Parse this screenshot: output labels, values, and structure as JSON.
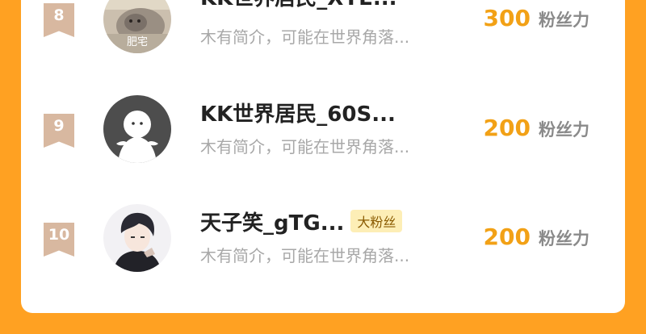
{
  "ranking": [
    {
      "rank": "8",
      "name": "KK世界居民_XYE...",
      "badge": "",
      "bio": "木有简介，可能在世界角落...",
      "fans": "300",
      "fans_unit": "粉丝力",
      "avatar_icon": "cat-photo-avatar",
      "avatar_caption": "肥宅"
    },
    {
      "rank": "9",
      "name": "KK世界居民_60S...",
      "badge": "",
      "bio": "木有简介，可能在世界角落...",
      "fans": "200",
      "fans_unit": "粉丝力",
      "avatar_icon": "default-ghost-avatar"
    },
    {
      "rank": "10",
      "name": "天子笑_gTG...",
      "badge": "大粉丝",
      "bio": "木有简介，可能在世界角落...",
      "fans": "200",
      "fans_unit": "粉丝力",
      "avatar_icon": "anime-boy-avatar"
    }
  ],
  "colors": {
    "page_background": "#ffa122",
    "fans_number": "#f2a116",
    "rank_badge": "#d8b8a0",
    "fan_badge_background": "#fdeeb6"
  }
}
